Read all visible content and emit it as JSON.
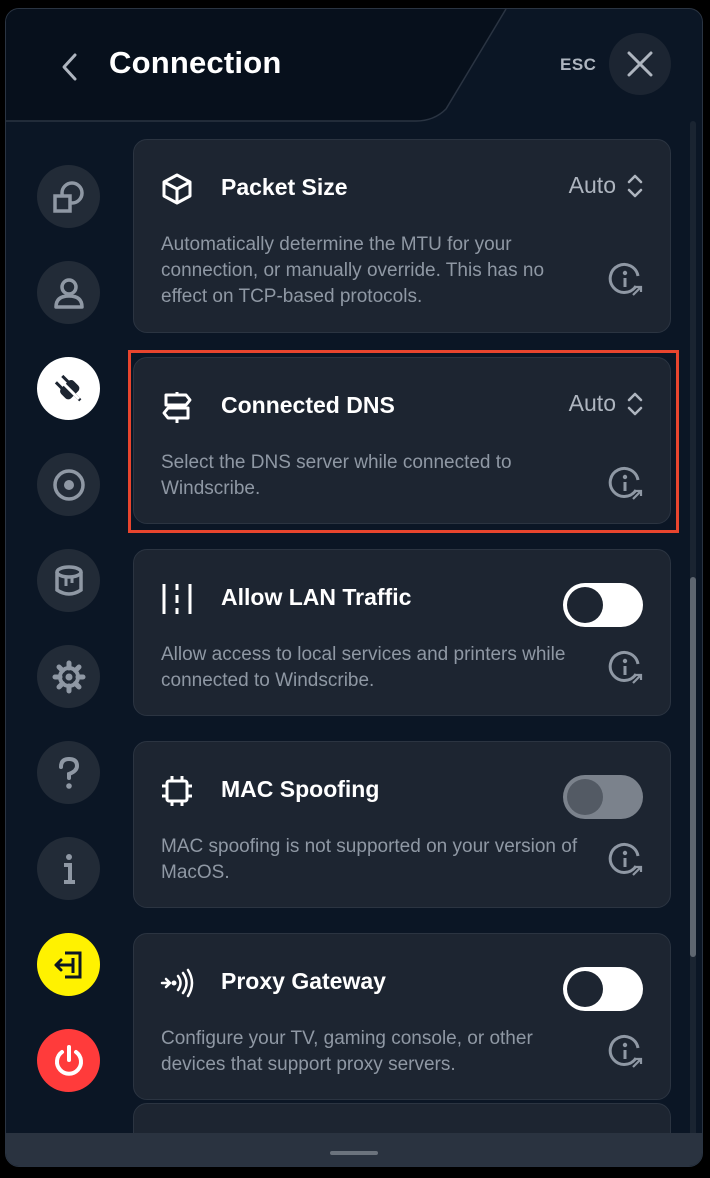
{
  "header": {
    "title": "Connection",
    "esc_label": "ESC"
  },
  "sidebar": {
    "items": [
      {
        "name": "general",
        "icon": "overlapping-squares-icon"
      },
      {
        "name": "account",
        "icon": "person-icon"
      },
      {
        "name": "connection",
        "icon": "plug-icon",
        "active": true
      },
      {
        "name": "robert",
        "icon": "robert-icon"
      },
      {
        "name": "advanced",
        "icon": "database-icon"
      },
      {
        "name": "settings",
        "icon": "gear-icon"
      },
      {
        "name": "help",
        "icon": "question-icon"
      },
      {
        "name": "about",
        "icon": "info-icon"
      },
      {
        "name": "logout",
        "icon": "exit-door-icon",
        "color": "#fff200"
      },
      {
        "name": "quit",
        "icon": "power-icon",
        "color": "#ff3b3b"
      }
    ]
  },
  "settings": [
    {
      "id": "packet-size",
      "title": "Packet Size",
      "icon": "cube-icon",
      "control": "dropdown",
      "value": "Auto",
      "description": "Automatically determine the MTU for your connection, or manually override.  This has no effect on TCP-based protocols."
    },
    {
      "id": "connected-dns",
      "title": "Connected DNS",
      "icon": "signpost-icon",
      "control": "dropdown",
      "value": "Auto",
      "highlighted": true,
      "description": "Select the DNS server while connected to Windscribe."
    },
    {
      "id": "allow-lan-traffic",
      "title": "Allow LAN Traffic",
      "icon": "lan-icon",
      "control": "toggle",
      "enabled": false,
      "description": "Allow access to local services and printers while connected to Windscribe."
    },
    {
      "id": "mac-spoofing",
      "title": "MAC Spoofing",
      "icon": "chip-icon",
      "control": "toggle",
      "enabled": false,
      "disabled": true,
      "description": "MAC spoofing is not supported on your version of MacOS."
    },
    {
      "id": "proxy-gateway",
      "title": "Proxy Gateway",
      "icon": "broadcast-icon",
      "control": "toggle",
      "enabled": false,
      "description": "Configure your TV, gaming console, or other devices that support proxy servers."
    }
  ],
  "colors": {
    "background": "#0b1625",
    "card": "#1d2531",
    "highlight": "#e8452e",
    "login_button": "#fff200",
    "power_button": "#ff3b3b"
  }
}
